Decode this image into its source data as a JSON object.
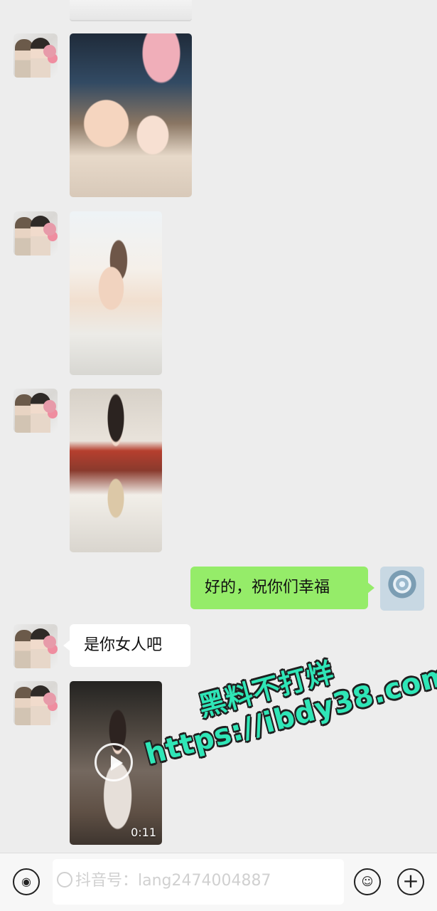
{
  "messages": [
    {
      "type": "image",
      "sender": "other"
    },
    {
      "type": "image",
      "sender": "other"
    },
    {
      "type": "image",
      "sender": "other"
    },
    {
      "type": "text",
      "sender": "me",
      "text": "好的，祝你们幸福"
    },
    {
      "type": "text",
      "sender": "other",
      "text": "是你女人吧"
    },
    {
      "type": "video",
      "sender": "other",
      "duration": "0:11"
    }
  ],
  "watermark": {
    "line1": "黑料不打烊",
    "line2": "https://ibdy38.com"
  },
  "composer": {
    "overlay_text": "抖音号：lang2474004887",
    "voice_icon": "voice-icon",
    "emoji_icon": "emoji-icon",
    "plus_icon": "plus-icon"
  },
  "colors": {
    "my_bubble": "#95ec69",
    "other_bubble": "#ffffff",
    "background": "#ededed",
    "watermark_fill": "#2fe6b7"
  }
}
